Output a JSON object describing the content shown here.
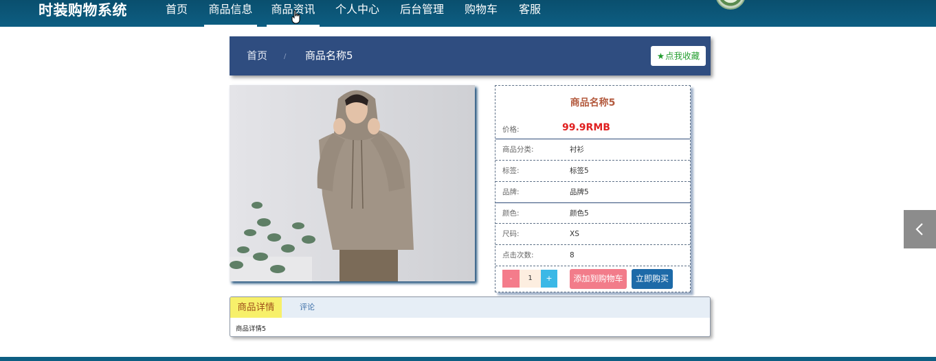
{
  "header": {
    "site_title": "时装购物系统",
    "nav": [
      "首页",
      "商品信息",
      "商品资讯",
      "个人中心",
      "后台管理",
      "购物车",
      "客服"
    ],
    "active_nav": [
      "商品信息",
      "商品资讯"
    ]
  },
  "breadcrumb": {
    "home": "首页",
    "separator": "/",
    "current": "商品名称5",
    "favorite_label": "点我收藏",
    "favorite_icon": "star-icon"
  },
  "product": {
    "name": "商品名称5",
    "price_label": "价格:",
    "price": "99.9RMB",
    "attributes": [
      {
        "label": "商品分类:",
        "value": "衬衫"
      },
      {
        "label": "标签:",
        "value": "标签5"
      },
      {
        "label": "品牌:",
        "value": "品牌5"
      },
      {
        "label": "颜色:",
        "value": "颜色5"
      },
      {
        "label": "尺码:",
        "value": "XS"
      },
      {
        "label": "点击次数:",
        "value": "8"
      }
    ],
    "quantity": "1",
    "minus_label": "-",
    "plus_label": "+",
    "add_to_cart_label": "添加到购物车",
    "buy_now_label": "立即购买"
  },
  "tabs": {
    "items": [
      "商品详情",
      "评论"
    ],
    "active": "商品详情",
    "content": "商品详情5"
  },
  "colors": {
    "nav_bg": "#0d5e82",
    "breadcrumb_bg": "#2f4d80",
    "price": "#e02020",
    "add_to_cart": "#f27c8a",
    "buy_now": "#1d6aa8",
    "tab_active": "#f7f06a"
  },
  "icons": {
    "side_toggle": "chevron-left-icon",
    "cursor": "hand-cursor-icon"
  }
}
